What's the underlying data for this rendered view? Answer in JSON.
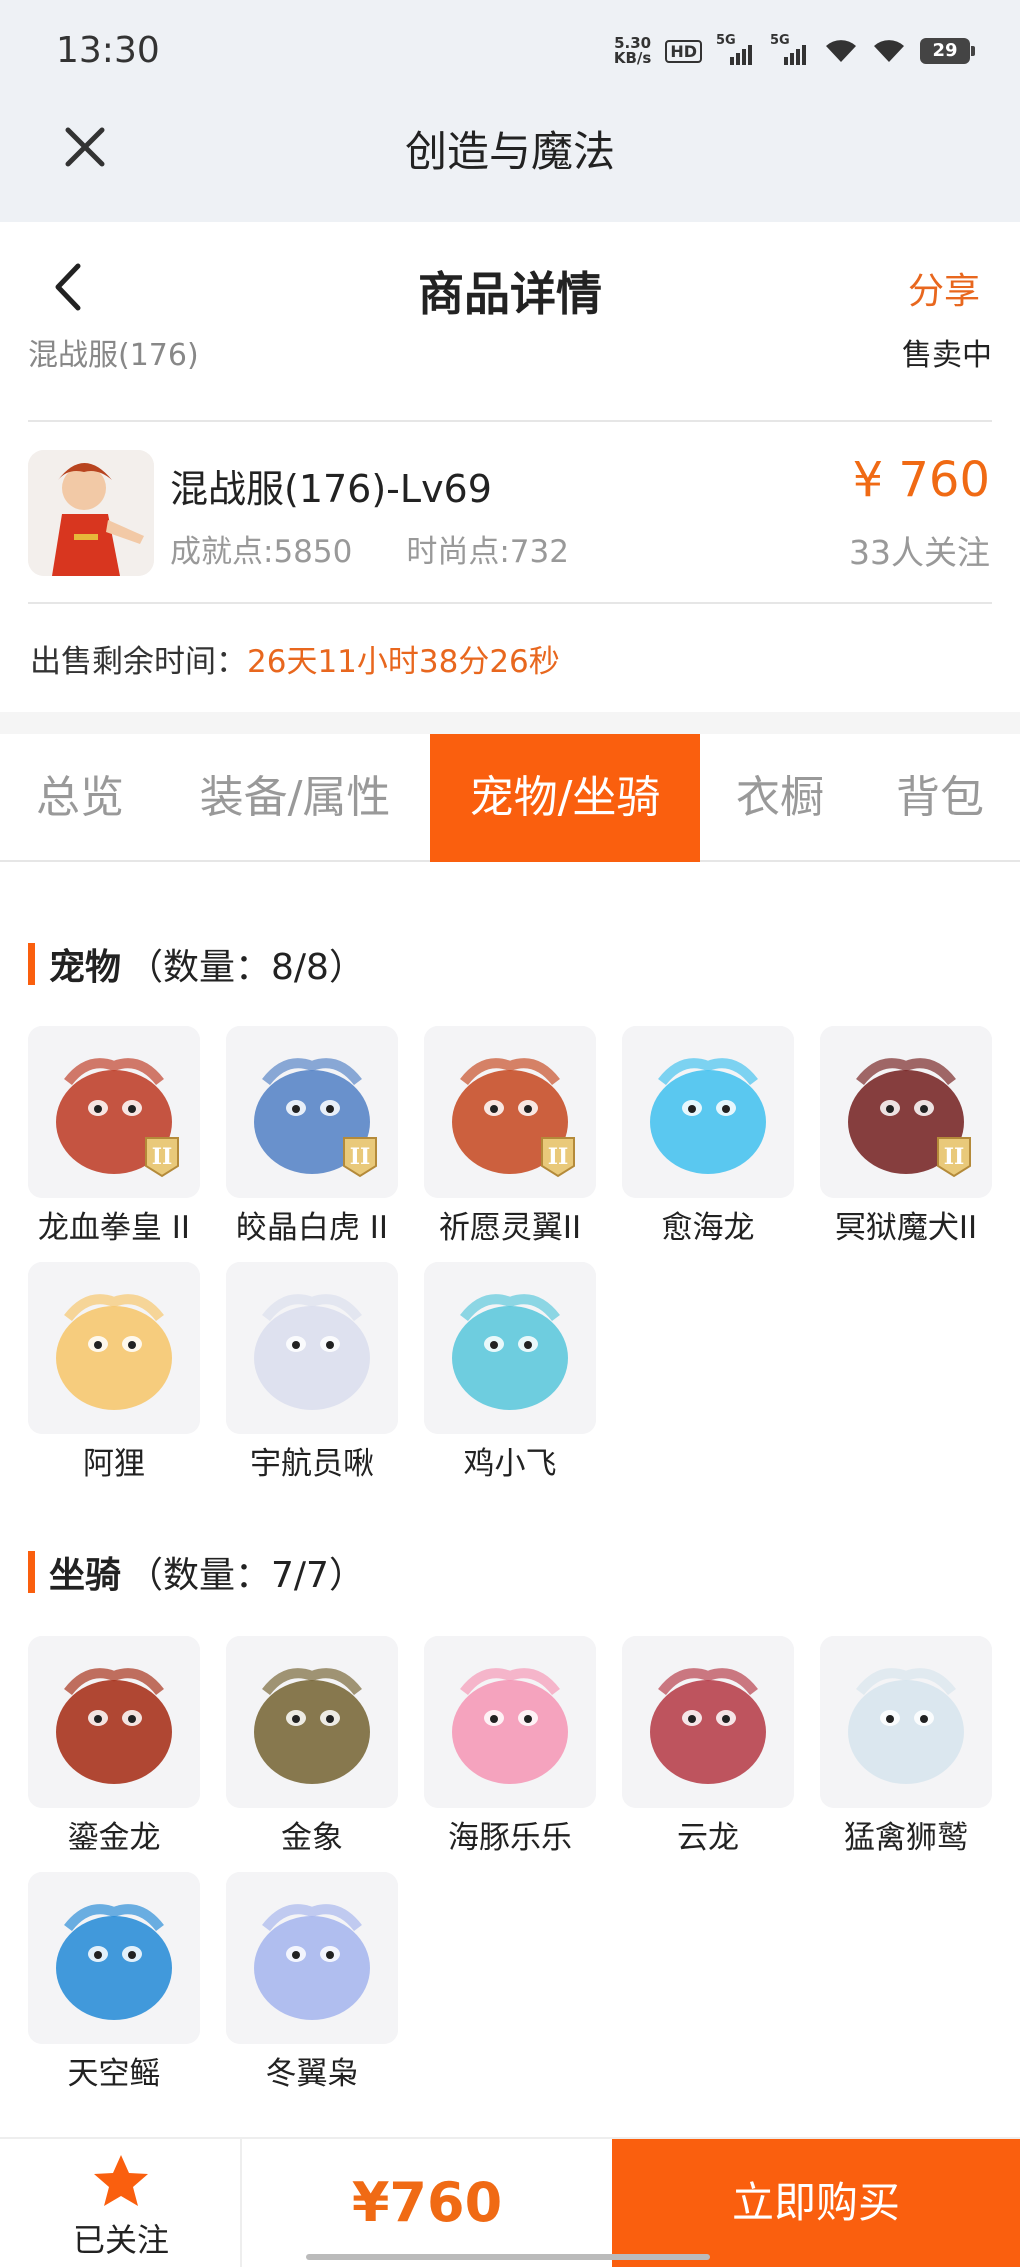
{
  "status_bar": {
    "time": "13:30",
    "net_speed_value": "5.30",
    "net_speed_unit": "KB/s",
    "hd": "HD",
    "sim1": "5G",
    "sim2": "5G",
    "battery": "29"
  },
  "app_header": {
    "title": "创造与魔法"
  },
  "page_header": {
    "title": "商品详情",
    "share": "分享"
  },
  "listing": {
    "clipped_server": "混战服(176)",
    "clipped_status": "售卖中",
    "character_name": "混战服(176)-Lv69",
    "achievement": "成就点:5850",
    "fashion": "时尚点:732",
    "price": "¥ 760",
    "followers": "33人关注",
    "remaining_label": "出售剩余时间：",
    "remaining_value": "26天11小时38分26秒"
  },
  "tabs": [
    {
      "label": "总览",
      "active": false
    },
    {
      "label": "装备/属性",
      "active": false
    },
    {
      "label": "宠物/坐骑",
      "active": true
    },
    {
      "label": "衣橱",
      "active": false
    },
    {
      "label": "背包",
      "active": false
    }
  ],
  "pets": {
    "title": "宠物",
    "count": "（数量：8/8）",
    "items": [
      {
        "name": "龙血拳皇 II",
        "color": "#c0432e",
        "tier": "II"
      },
      {
        "name": "皎晶白虎 II",
        "color": "#5a86c8",
        "tier": "II"
      },
      {
        "name": "祈愿灵翼II",
        "color": "#c8502a",
        "tier": "II"
      },
      {
        "name": "愈海龙",
        "color": "#49c3ef",
        "tier": ""
      },
      {
        "name": "冥狱魔犬II",
        "color": "#7a2a2a",
        "tier": "II"
      },
      {
        "name": "阿狸",
        "color": "#f6c870",
        "tier": ""
      },
      {
        "name": "宇航员啾",
        "color": "#dcdfee",
        "tier": ""
      },
      {
        "name": "鸡小飞",
        "color": "#5fc9dd",
        "tier": ""
      }
    ]
  },
  "mounts": {
    "title": "坐骑",
    "count": "（数量：7/7）",
    "items": [
      {
        "name": "鎏金龙",
        "color": "#a8341e"
      },
      {
        "name": "金象",
        "color": "#7b6a3c"
      },
      {
        "name": "海豚乐乐",
        "color": "#f59ab8"
      },
      {
        "name": "云龙",
        "color": "#b8424e"
      },
      {
        "name": "猛禽狮鹫",
        "color": "#d8e6ee"
      },
      {
        "name": "天空鳐",
        "color": "#2d8fd8"
      },
      {
        "name": "冬翼枭",
        "color": "#a9b8ee"
      }
    ]
  },
  "bottom_bar": {
    "follow_label": "已关注",
    "price": "¥760",
    "buy_label": "立即购买"
  }
}
